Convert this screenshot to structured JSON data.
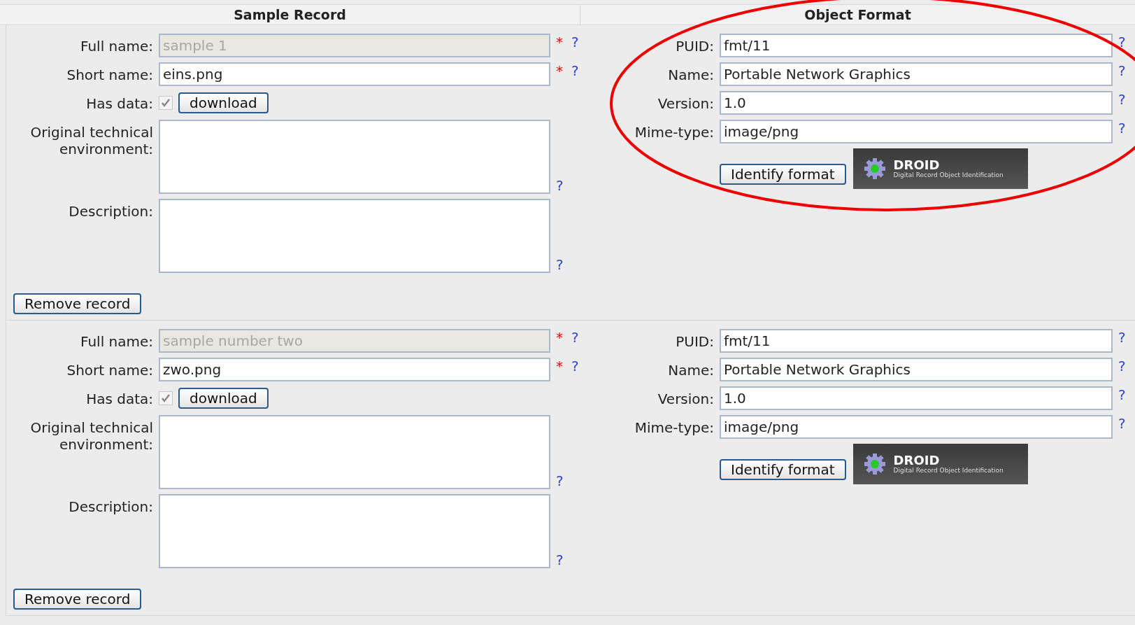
{
  "headers": [
    "Sample Record",
    "Object Format"
  ],
  "records": [
    {
      "fields": [
        {
          "kind": "text",
          "label": "Full name:",
          "value": "sample 1",
          "disabled": true,
          "required_mark": "*",
          "help": "?"
        },
        {
          "kind": "text",
          "label": "Short name:",
          "value": "eins.png",
          "disabled": false,
          "required_mark": "*",
          "help": "?"
        },
        {
          "kind": "checkbox",
          "label": "Has data:",
          "checked": true,
          "disabled": true,
          "button": "download"
        },
        {
          "kind": "textarea",
          "label": "Original technical environment:",
          "help": "?"
        },
        {
          "kind": "textarea",
          "label": "Description:",
          "help": "?"
        }
      ],
      "remove_button": "Remove record",
      "format": {
        "fields": [
          {
            "label": "PUID:",
            "value": "fmt/11",
            "help": "?"
          },
          {
            "label": "Name:",
            "value": "Portable Network Graphics",
            "help": "?"
          },
          {
            "label": "Version:",
            "value": "1.0",
            "help": "?"
          },
          {
            "label": "Mime-type:",
            "value": "image/png",
            "help": "?"
          }
        ],
        "identify_button": "Identify format",
        "logo": {
          "title": "DROID",
          "subtitle": "Digital Record Object Identification"
        }
      }
    },
    {
      "fields": [
        {
          "kind": "text",
          "label": "Full name:",
          "value": "sample number two",
          "disabled": true,
          "required_mark": "*",
          "help": "?"
        },
        {
          "kind": "text",
          "label": "Short name:",
          "value": "zwo.png",
          "disabled": false,
          "required_mark": "*",
          "help": "?"
        },
        {
          "kind": "checkbox",
          "label": "Has data:",
          "checked": true,
          "disabled": true,
          "button": "download"
        },
        {
          "kind": "textarea",
          "label": "Original technical environment:",
          "help": "?"
        },
        {
          "kind": "textarea",
          "label": "Description:",
          "help": "?"
        }
      ],
      "remove_button": "Remove record",
      "format": {
        "fields": [
          {
            "label": "PUID:",
            "value": "fmt/11",
            "help": "?"
          },
          {
            "label": "Name:",
            "value": "Portable Network Graphics",
            "help": "?"
          },
          {
            "label": "Version:",
            "value": "1.0",
            "help": "?"
          },
          {
            "label": "Mime-type:",
            "value": "image/png",
            "help": "?"
          }
        ],
        "identify_button": "Identify format",
        "logo": {
          "title": "DROID",
          "subtitle": "Digital Record Object Identification"
        }
      }
    }
  ],
  "annotation": {
    "kind": "ellipse"
  }
}
